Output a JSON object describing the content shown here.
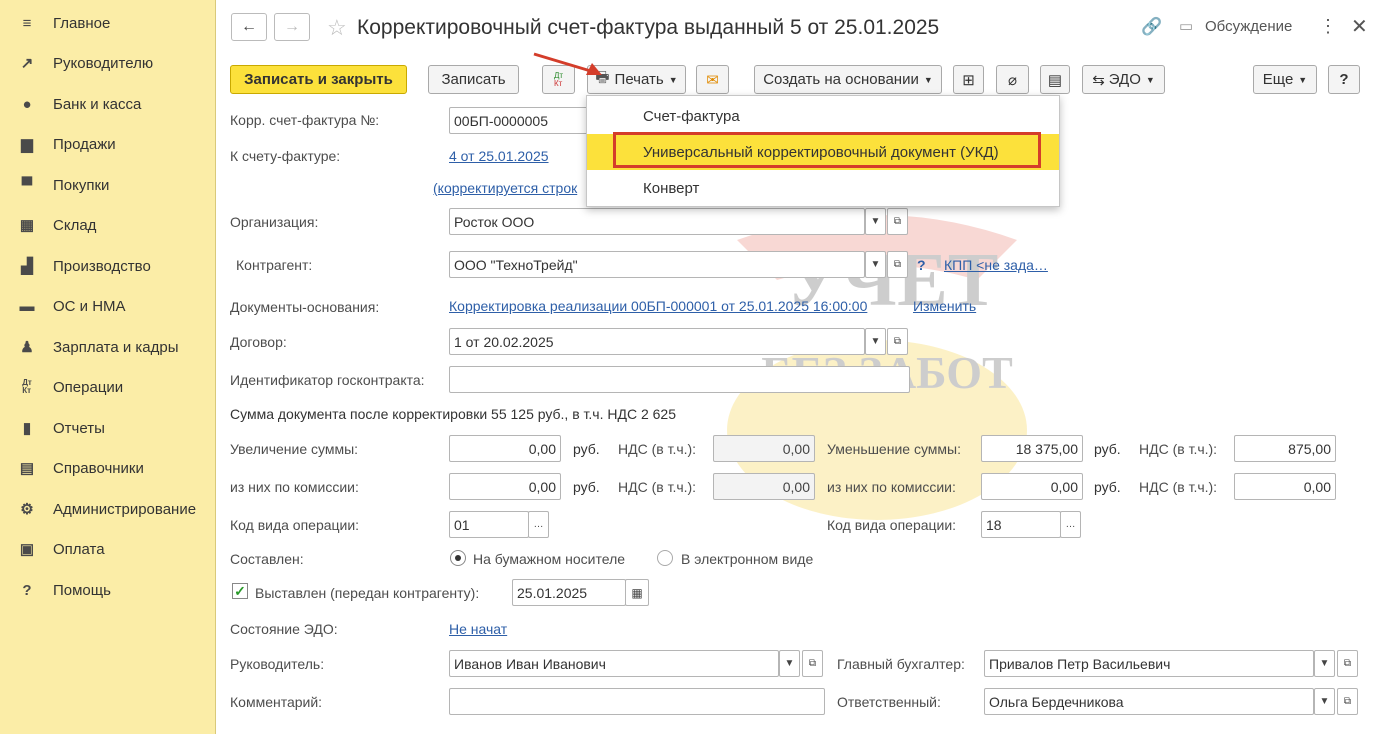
{
  "sidebar": {
    "items": [
      {
        "label": "Главное",
        "icon": "menu-icon"
      },
      {
        "label": "Руководителю",
        "icon": "chart-line-icon"
      },
      {
        "label": "Банк и касса",
        "icon": "coin-icon"
      },
      {
        "label": "Продажи",
        "icon": "bag-icon"
      },
      {
        "label": "Покупки",
        "icon": "cart-icon"
      },
      {
        "label": "Склад",
        "icon": "grid-icon"
      },
      {
        "label": "Производство",
        "icon": "factory-icon"
      },
      {
        "label": "ОС и НМА",
        "icon": "truck-icon"
      },
      {
        "label": "Зарплата и кадры",
        "icon": "person-icon"
      },
      {
        "label": "Операции",
        "icon": "dt-kt-icon"
      },
      {
        "label": "Отчеты",
        "icon": "bar-chart-icon"
      },
      {
        "label": "Справочники",
        "icon": "book-icon"
      },
      {
        "label": "Администрирование",
        "icon": "gear-icon"
      },
      {
        "label": "Оплата",
        "icon": "wallet-icon"
      },
      {
        "label": "Помощь",
        "icon": "question-icon"
      }
    ]
  },
  "header": {
    "title": "Корректировочный счет-фактура выданный 5 от 25.01.2025",
    "discussion": "Обсуждение"
  },
  "toolbar": {
    "save_close": "Записать и закрыть",
    "save": "Записать",
    "dtkt": "Дт Кт",
    "print": "Печать",
    "create_based": "Создать на основании",
    "edo": "ЭДО",
    "more": "Еще",
    "help": "?"
  },
  "print_menu": {
    "items": [
      "Счет-фактура",
      "Универсальный корректировочный документ (УКД)",
      "Конверт"
    ]
  },
  "form": {
    "corr_label": "Корр. счет-фактура №:",
    "corr_value": "00БП-0000005",
    "to_invoice_label": "К счету-фактуре:",
    "to_invoice_link": "4 от 25.01.2025",
    "corrected_link": "(корректируется строк",
    "org_label": "Организация:",
    "org_value": "Росток ООО",
    "contragent_label": "Контрагент:",
    "contragent_value": "ООО \"ТехноТрейд\"",
    "kpp_q": "?",
    "kpp_link": "КПП <не зада…",
    "docs_label": "Документы-основания:",
    "docs_link": "Корректировка реализации 00БП-000001 от 25.01.2025 16:00:00",
    "docs_change": "Изменить",
    "contract_label": "Договор:",
    "contract_value": "1 от 20.02.2025",
    "gos_label": "Идентификатор госконтракта:",
    "gos_value": "",
    "sum_text": "Сумма документа после корректировки 55 125 руб., в т.ч. НДС 2 625",
    "inc_label": "Увеличение суммы:",
    "inc_value": "0,00",
    "rub": "руб.",
    "vat_label": "НДС (в т.ч.):",
    "inc_vat": "0,00",
    "dec_label": "Уменьшение суммы:",
    "dec_value": "18 375,00",
    "dec_vat": "875,00",
    "comm_label": "из них по комиссии:",
    "comm_inc": "0,00",
    "comm_inc_vat": "0,00",
    "comm_dec": "0,00",
    "comm_dec_vat": "0,00",
    "op_code_label": "Код вида операции:",
    "op_code_1": "01",
    "op_code_2": "18",
    "composed_label": "Составлен:",
    "radio_paper": "На бумажном носителе",
    "radio_electronic": "В электронном виде",
    "issued_label": "Выставлен (передан контрагенту):",
    "issued_date": "25.01.2025",
    "edo_state_label": "Состояние ЭДО:",
    "edo_state_link": "Не начат",
    "director_label": "Руководитель:",
    "director_value": "Иванов Иван Иванович",
    "chief_label": "Главный бухгалтер:",
    "chief_value": "Привалов Петр Васильевич",
    "comment_label": "Комментарий:",
    "comment_value": "",
    "responsible_label": "Ответственный:",
    "responsible_value": "Ольга Бердечникова"
  },
  "watermark": {
    "line1": "УЧЕТ",
    "line2": "БЕЗ ЗАБОТ"
  },
  "colors": {
    "sidebar": "#fbeda7",
    "accent": "#fce13b",
    "link": "#2e5fa8",
    "highlight_border": "#d43d2a"
  }
}
